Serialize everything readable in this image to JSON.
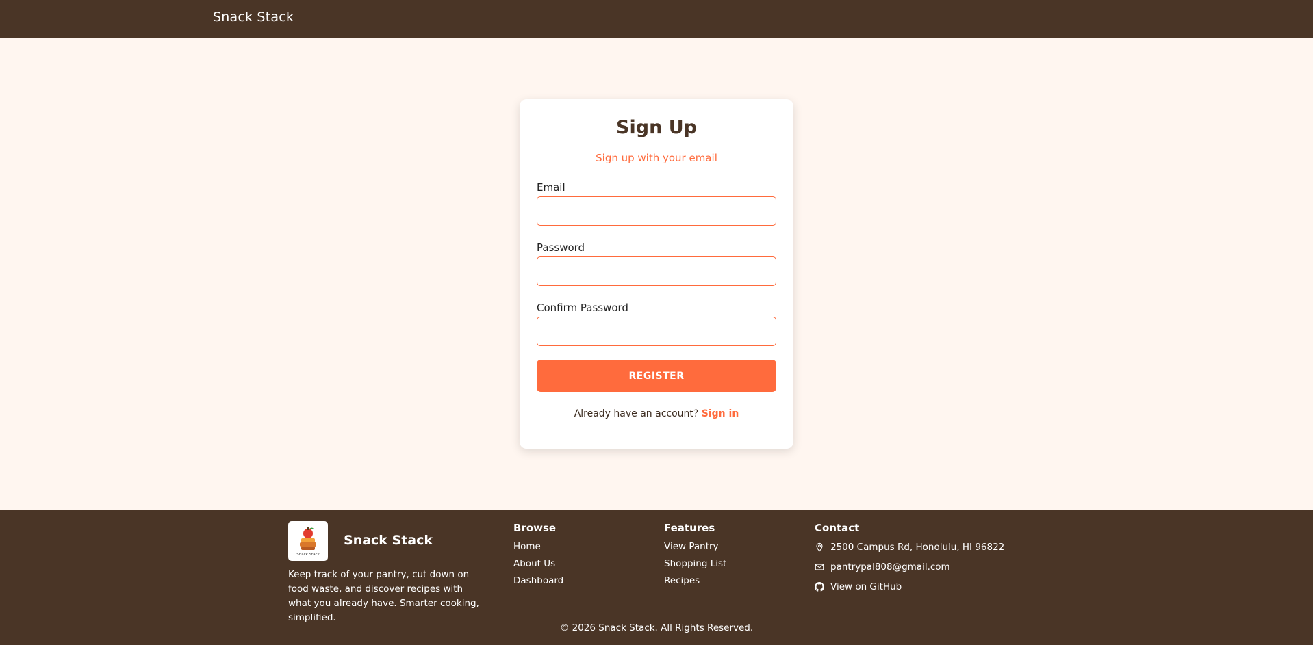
{
  "navbar": {
    "brand": "Snack Stack"
  },
  "signup": {
    "title": "Sign Up",
    "subtitle": "Sign up with your email",
    "email_label": "Email",
    "email_value": "",
    "password_label": "Password",
    "password_value": "",
    "confirm_label": "Confirm Password",
    "confirm_value": "",
    "register_label": "REGISTER",
    "signin_prompt": "Already have an account?",
    "signin_link": "Sign in"
  },
  "footer": {
    "brand": "Snack Stack",
    "logo_text": "Snack Stack",
    "description": "Keep track of your pantry, cut down on food waste, and discover recipes with what you already have. Smarter cooking, simplified.",
    "browse": {
      "heading": "Browse",
      "links": [
        "Home",
        "About Us",
        "Dashboard"
      ]
    },
    "features": {
      "heading": "Features",
      "links": [
        "View Pantry",
        "Shopping List",
        "Recipes"
      ]
    },
    "contact": {
      "heading": "Contact",
      "address": "2500 Campus Rd, Honolulu, HI 96822",
      "email": "pantrypal808@gmail.com",
      "github": "View on GitHub"
    },
    "copyright": "© 2026 Snack Stack. All Rights Reserved."
  },
  "colors": {
    "brown": "#4a3526",
    "accent": "#ff6b3d",
    "background": "#fff6f0"
  },
  "icons": [
    "map-pin-icon",
    "mail-icon",
    "github-icon",
    "snack-stack-logo-icon"
  ]
}
